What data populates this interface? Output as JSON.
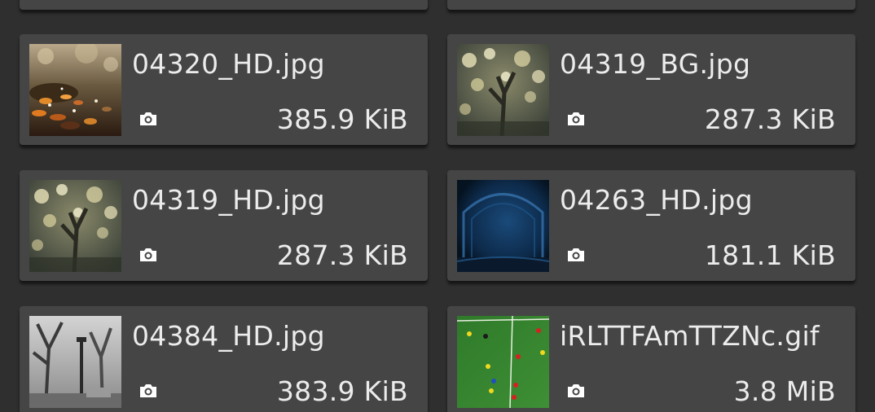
{
  "files": [
    {
      "name": "04320_HD.jpg",
      "size": "385.9 KiB",
      "thumb": "autumn-leaves",
      "icon": "camera-icon"
    },
    {
      "name": "04319_BG.jpg",
      "size": "287.3 KiB",
      "thumb": "bokeh-tree",
      "icon": "camera-icon"
    },
    {
      "name": "04319_HD.jpg",
      "size": "287.3 KiB",
      "thumb": "bokeh-tree",
      "icon": "camera-icon"
    },
    {
      "name": "04263_HD.jpg",
      "size": "181.1 KiB",
      "thumb": "blue-arch",
      "icon": "camera-icon"
    },
    {
      "name": "04384_HD.jpg",
      "size": "383.9 KiB",
      "thumb": "bw-park",
      "icon": "camera-icon"
    },
    {
      "name": "iRLTTFAmTTZNc.gif",
      "size": "3.8 MiB",
      "thumb": "soccer-field",
      "icon": "camera-icon"
    }
  ],
  "colors": {
    "background": "#2f2f2f",
    "card": "#454545",
    "text": "#ececec"
  }
}
